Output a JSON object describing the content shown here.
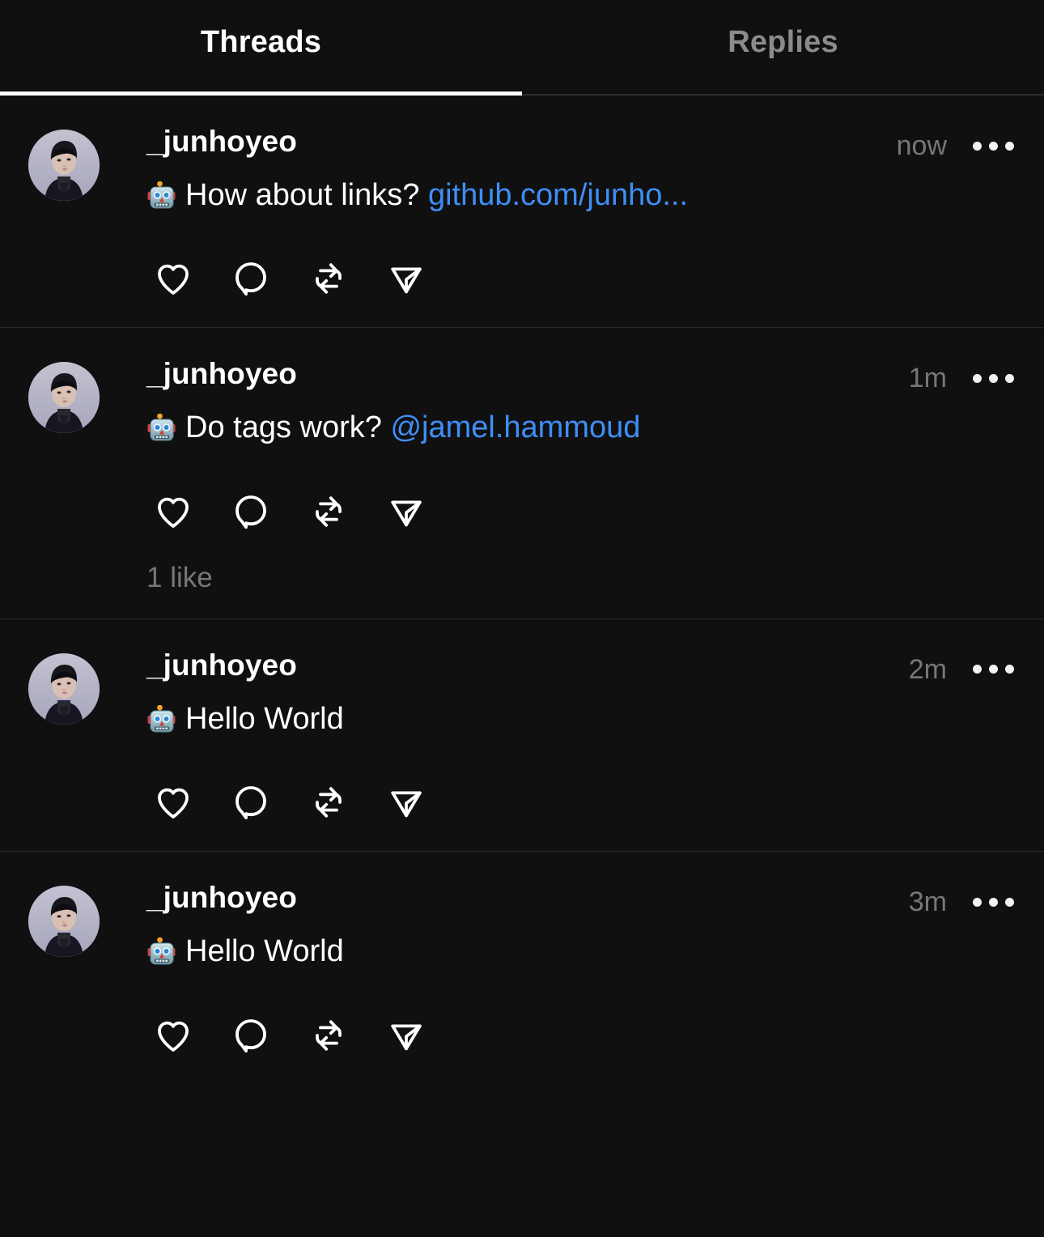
{
  "app": {
    "name": "Threads",
    "theme": "dark",
    "background_color": "#101010",
    "accent_link_color": "#3f8ef6",
    "muted_text_color": "#777777",
    "divider_color": "#2a2a2a"
  },
  "tabs": [
    {
      "label": "Threads",
      "active": true
    },
    {
      "label": "Replies",
      "active": false
    }
  ],
  "posts": [
    {
      "username": "_junhoyeo",
      "timestamp": "now",
      "emoji": "robot-face",
      "text": "How about links? ",
      "link_text": "github.com/junho...",
      "link_kind": "url",
      "likes_label": "",
      "actions": [
        "like",
        "comment",
        "repost",
        "share"
      ],
      "more_label": "More options"
    },
    {
      "username": "_junhoyeo",
      "timestamp": "1m",
      "emoji": "robot-face",
      "text": "Do tags work? ",
      "link_text": "@jamel.hammoud",
      "link_kind": "mention",
      "likes_label": "1 like",
      "actions": [
        "like",
        "comment",
        "repost",
        "share"
      ],
      "more_label": "More options"
    },
    {
      "username": "_junhoyeo",
      "timestamp": "2m",
      "emoji": "robot-face",
      "text": "Hello World",
      "link_text": "",
      "link_kind": "",
      "likes_label": "",
      "actions": [
        "like",
        "comment",
        "repost",
        "share"
      ],
      "more_label": "More options"
    },
    {
      "username": "_junhoyeo",
      "timestamp": "3m",
      "emoji": "robot-face",
      "text": "Hello World",
      "link_text": "",
      "link_kind": "",
      "likes_label": "",
      "actions": [
        "like",
        "comment",
        "repost",
        "share"
      ],
      "more_label": "More options"
    }
  ]
}
